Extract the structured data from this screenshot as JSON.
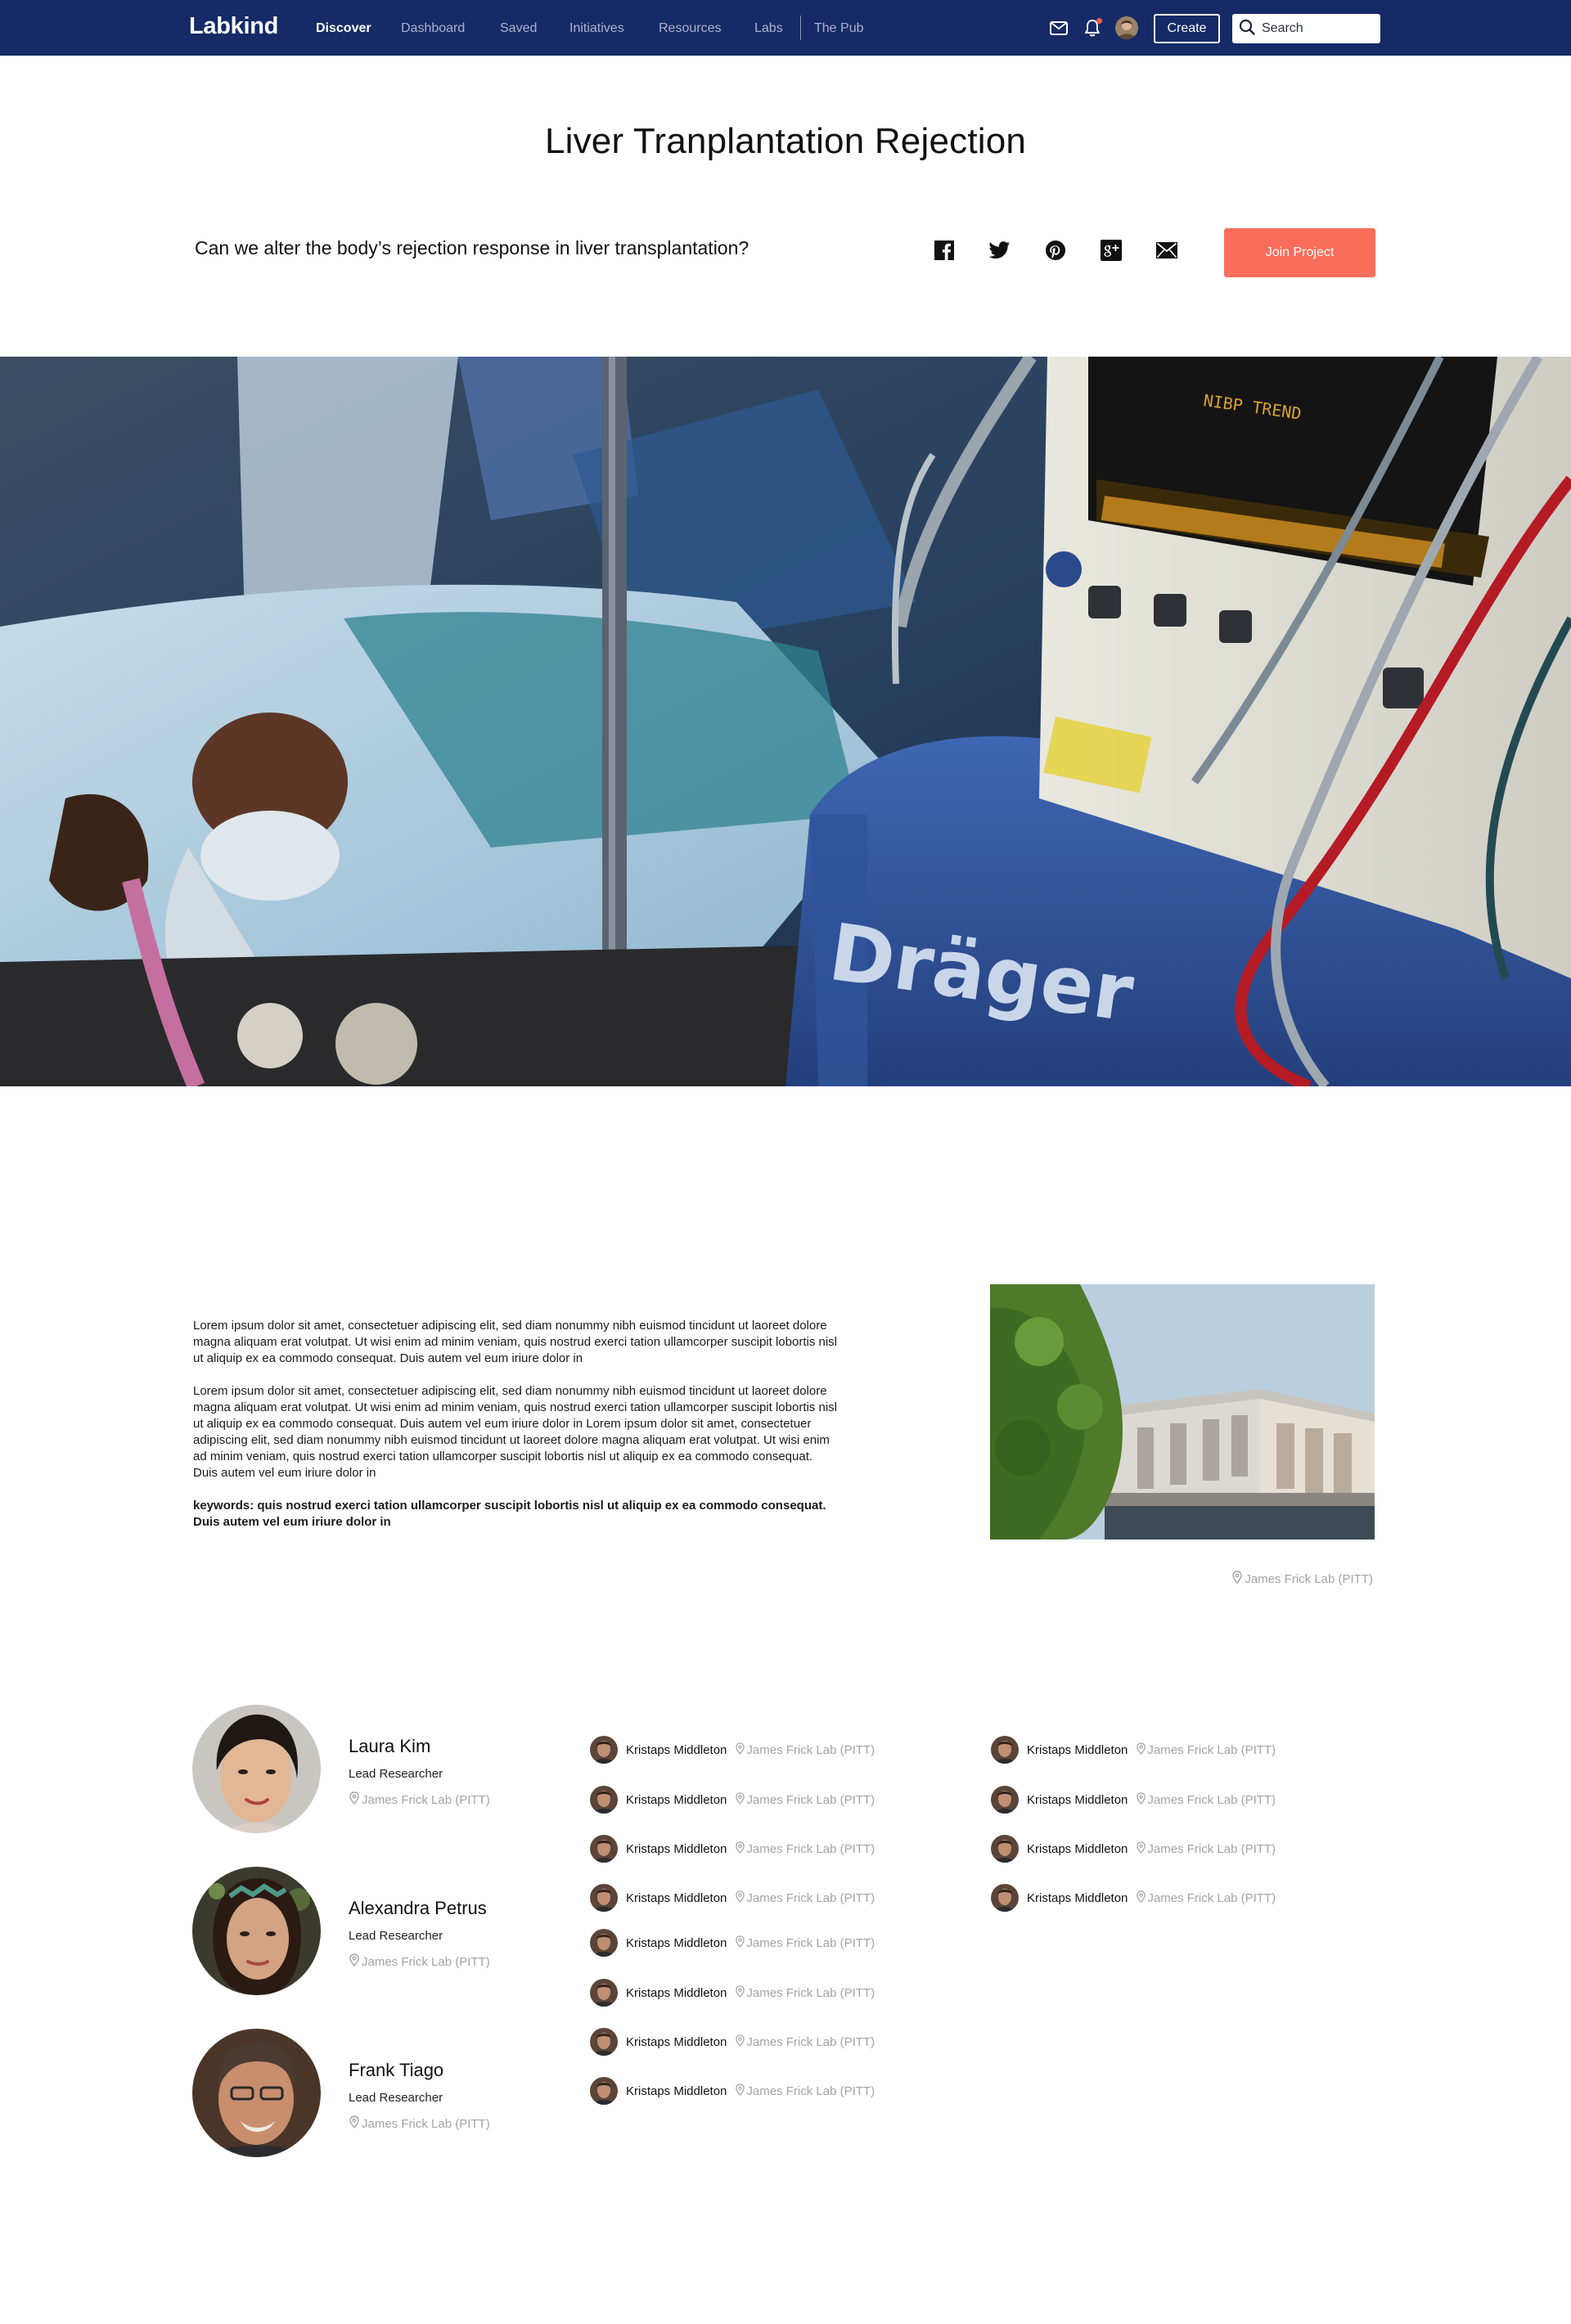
{
  "nav": {
    "logo": "Labkind",
    "links": [
      "Discover",
      "Dashboard",
      "Saved",
      "Initiatives",
      "Resources",
      "Labs",
      "The Pub"
    ],
    "active": "Discover",
    "create_label": "Create",
    "search_label": "Search",
    "icons": [
      "mail-icon",
      "bell-icon",
      "avatar",
      "search-icon"
    ]
  },
  "project": {
    "title": "Liver Tranplantation Rejection",
    "question": "Can we alter the body’s rejection response in liver transplantation?",
    "join_label": "Join Project",
    "share_icons": [
      "facebook-icon",
      "twitter-icon",
      "pinterest-icon",
      "google-plus-icon",
      "email-icon"
    ]
  },
  "description": {
    "paragraph_1": "Lorem ipsum dolor sit amet, consectetuer adipiscing elit, sed diam nonummy nibh euismod tincidunt ut laoreet dolore magna aliquam erat volutpat. Ut wisi enim ad minim veniam, quis nostrud exerci tation ullamcorper suscipit lobortis nisl ut aliquip ex ea commodo consequat. Duis autem vel eum iriure dolor in",
    "paragraph_2": "Lorem ipsum dolor sit amet, consectetuer adipiscing elit, sed diam nonummy nibh euismod tincidunt ut laoreet dolore magna aliquam erat volutpat. Ut wisi enim ad minim veniam, quis nostrud exerci tation ullamcorper suscipit lobortis nisl ut aliquip ex ea commodo consequat. Duis autem vel eum iriure dolor in Lorem ipsum dolor sit amet, consectetuer adipiscing elit, sed diam nonummy nibh euismod tincidunt ut laoreet dolore magna aliquam erat volutpat. Ut wisi enim ad minim veniam, quis nostrud exerci tation ullamcorper suscipit lobortis nisl ut aliquip ex ea commodo consequat. Duis autem vel eum iriure dolor in",
    "keywords": "keywords: quis nostrud exerci tation ullamcorper suscipit lobortis nisl ut aliquip ex ea commodo consequat. Duis autem vel eum iriure dolor in",
    "lab_caption": "James Frick Lab (PITT)"
  },
  "leads": [
    {
      "name": "Laura Kim",
      "role": "Lead Researcher",
      "lab": "James Frick Lab (PITT)"
    },
    {
      "name": "Alexandra Petrus",
      "role": "Lead Researcher",
      "lab": "James Frick Lab (PITT)"
    },
    {
      "name": "Frank Tiago",
      "role": "Lead Researcher",
      "lab": "James Frick Lab (PITT)"
    }
  ],
  "members_col_1": [
    {
      "name": "Kristaps Middleton",
      "lab": "James Frick Lab (PITT)"
    },
    {
      "name": "Kristaps Middleton",
      "lab": "James Frick Lab (PITT)"
    },
    {
      "name": "Kristaps Middleton",
      "lab": "James Frick Lab (PITT)"
    },
    {
      "name": "Kristaps Middleton",
      "lab": "James Frick Lab (PITT)"
    },
    {
      "name": "Kristaps Middleton",
      "lab": "James Frick Lab (PITT)"
    },
    {
      "name": "Kristaps Middleton",
      "lab": "James Frick Lab (PITT)"
    },
    {
      "name": "Kristaps Middleton",
      "lab": "James Frick Lab (PITT)"
    },
    {
      "name": "Kristaps Middleton",
      "lab": "James Frick Lab (PITT)"
    }
  ],
  "members_col_2": [
    {
      "name": "Kristaps Middleton",
      "lab": "James Frick Lab (PITT)"
    },
    {
      "name": "Kristaps Middleton",
      "lab": "James Frick Lab (PITT)"
    },
    {
      "name": "Kristaps Middleton",
      "lab": "James Frick Lab (PITT)"
    },
    {
      "name": "Kristaps Middleton",
      "lab": "James Frick Lab (PITT)"
    }
  ],
  "colors": {
    "nav_bg": "#152a66",
    "accent": "#f96e5a",
    "muted_text": "#a3a3a3"
  }
}
